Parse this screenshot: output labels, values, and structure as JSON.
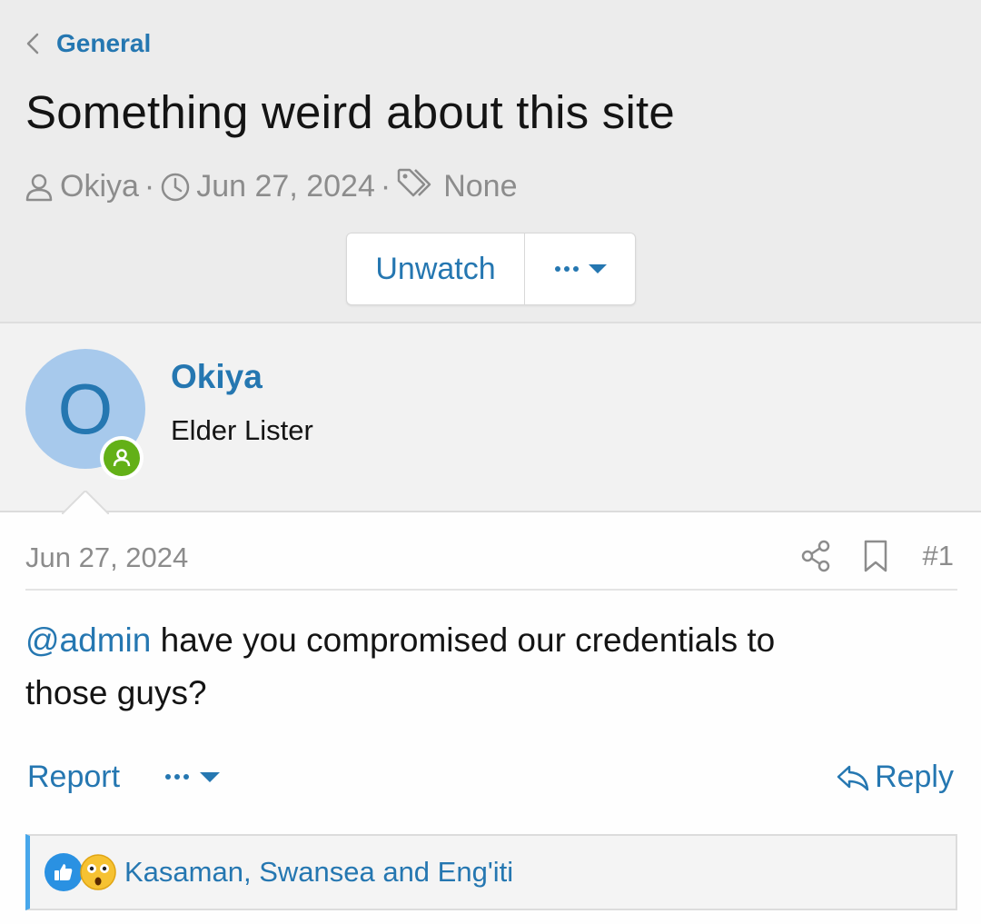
{
  "breadcrumb": {
    "label": "General"
  },
  "thread": {
    "title": "Something weird about this site",
    "author": "Okiya",
    "date": "Jun 27, 2024",
    "tags": "None",
    "separator": "·"
  },
  "actions": {
    "unwatch_label": "Unwatch"
  },
  "post": {
    "author_initial": "O",
    "author_name": "Okiya",
    "author_title": "Elder Lister",
    "date": "Jun 27, 2024",
    "number": "#1",
    "mention": "@admin",
    "body_line1": " have you compromised our credentials to",
    "body_line2": "those guys?",
    "report_label": "Report",
    "reply_label": "Reply",
    "reactions_names": "Kasaman, Swansea and Eng'iti"
  },
  "colors": {
    "link": "#2577b1",
    "header_bg": "#ececec",
    "online": "#63b017",
    "avatar_bg": "#a7c9ec",
    "reaction_bar": "#47a7eb"
  }
}
